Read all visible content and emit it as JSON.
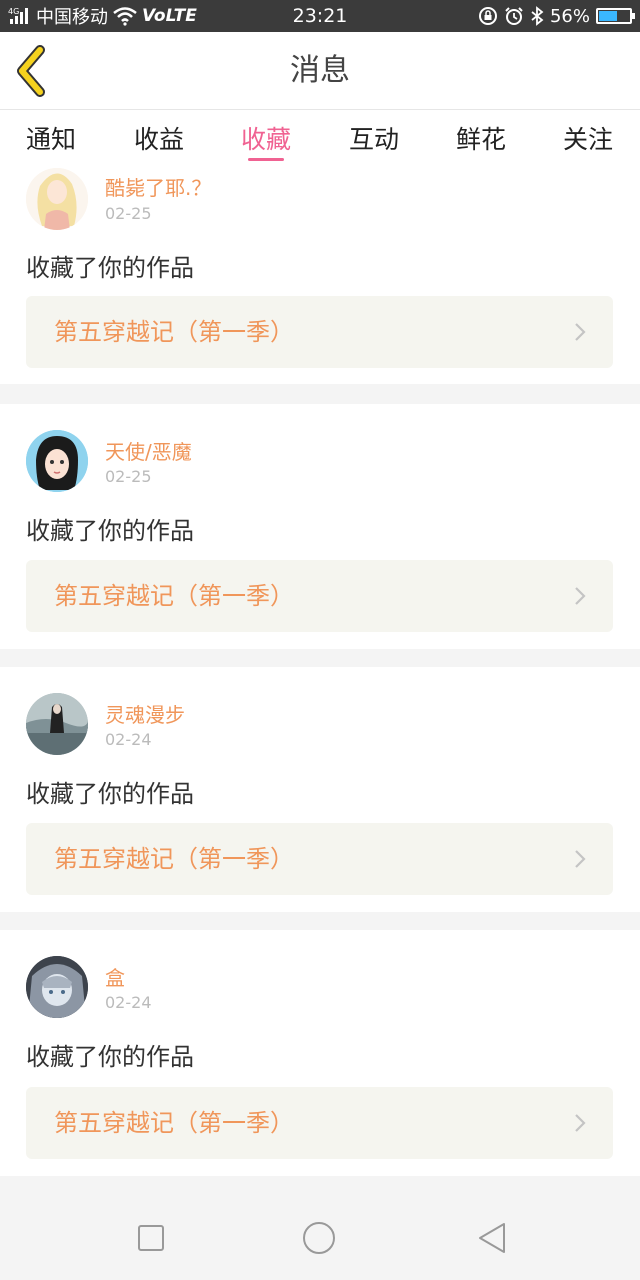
{
  "status_bar": {
    "network": "4G",
    "carrier": "中国移动",
    "volte": "VoLTE",
    "time": "23:21",
    "battery_percent": "56%",
    "battery_level": 0.56,
    "icons": [
      "signal-icon",
      "wifi-icon",
      "lock-rotate-icon",
      "alarm-icon",
      "bluetooth-icon",
      "battery-icon"
    ]
  },
  "header": {
    "back_icon": "chevron-left-icon",
    "title": "消息"
  },
  "tabs": [
    {
      "label": "通知",
      "active": false
    },
    {
      "label": "收益",
      "active": false
    },
    {
      "label": "收藏",
      "active": true
    },
    {
      "label": "互动",
      "active": false
    },
    {
      "label": "鲜花",
      "active": false
    },
    {
      "label": "关注",
      "active": false
    }
  ],
  "items": [
    {
      "username": "酷毙了耶.？",
      "date": "02-25",
      "action": "收藏了你的作品",
      "work_title": "第五穿越记（第一季）"
    },
    {
      "username": "天使/恶魔",
      "date": "02-25",
      "action": "收藏了你的作品",
      "work_title": "第五穿越记（第一季）"
    },
    {
      "username": "灵魂漫步",
      "date": "02-24",
      "action": "收藏了你的作品",
      "work_title": "第五穿越记（第一季）"
    },
    {
      "username": "盒",
      "date": "02-24",
      "action": "收藏了你的作品",
      "work_title": "第五穿越记（第一季）"
    }
  ],
  "nav_bar": {
    "recent_icon": "square-icon",
    "home_icon": "circle-icon",
    "back_icon": "triangle-back-icon"
  },
  "colors": {
    "accent": "#f06292",
    "username": "#f0965a",
    "back_arrow": "#f5d21e"
  }
}
